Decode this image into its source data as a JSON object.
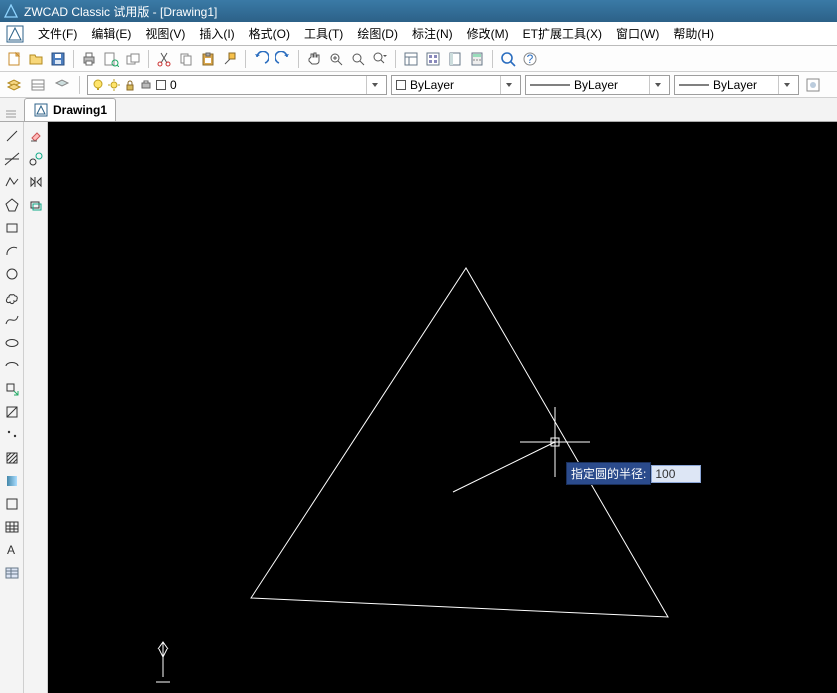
{
  "title": "ZWCAD Classic 试用版 - [Drawing1]",
  "menu": [
    "文件(F)",
    "编辑(E)",
    "视图(V)",
    "插入(I)",
    "格式(O)",
    "工具(T)",
    "绘图(D)",
    "标注(N)",
    "修改(M)",
    "ET扩展工具(X)",
    "窗口(W)",
    "帮助(H)"
  ],
  "tab": {
    "label": "Drawing1"
  },
  "layer": {
    "value": "0",
    "color": "#ffffff"
  },
  "byLayer1": "ByLayer",
  "byLayer2": "ByLayer",
  "byLayer3": "ByLayer",
  "dynInput": {
    "label": "指定圆的半径:",
    "value": "100"
  },
  "icons": {
    "new": "new",
    "open": "open",
    "save": "save",
    "print": "print",
    "preview": "preview",
    "cut": "cut",
    "copy": "copy",
    "paste": "paste",
    "match": "match",
    "undo": "undo",
    "redo": "redo",
    "pan": "pan",
    "zoom": "zoom",
    "zoomE": "zoomE",
    "zoomW": "zoomW"
  }
}
